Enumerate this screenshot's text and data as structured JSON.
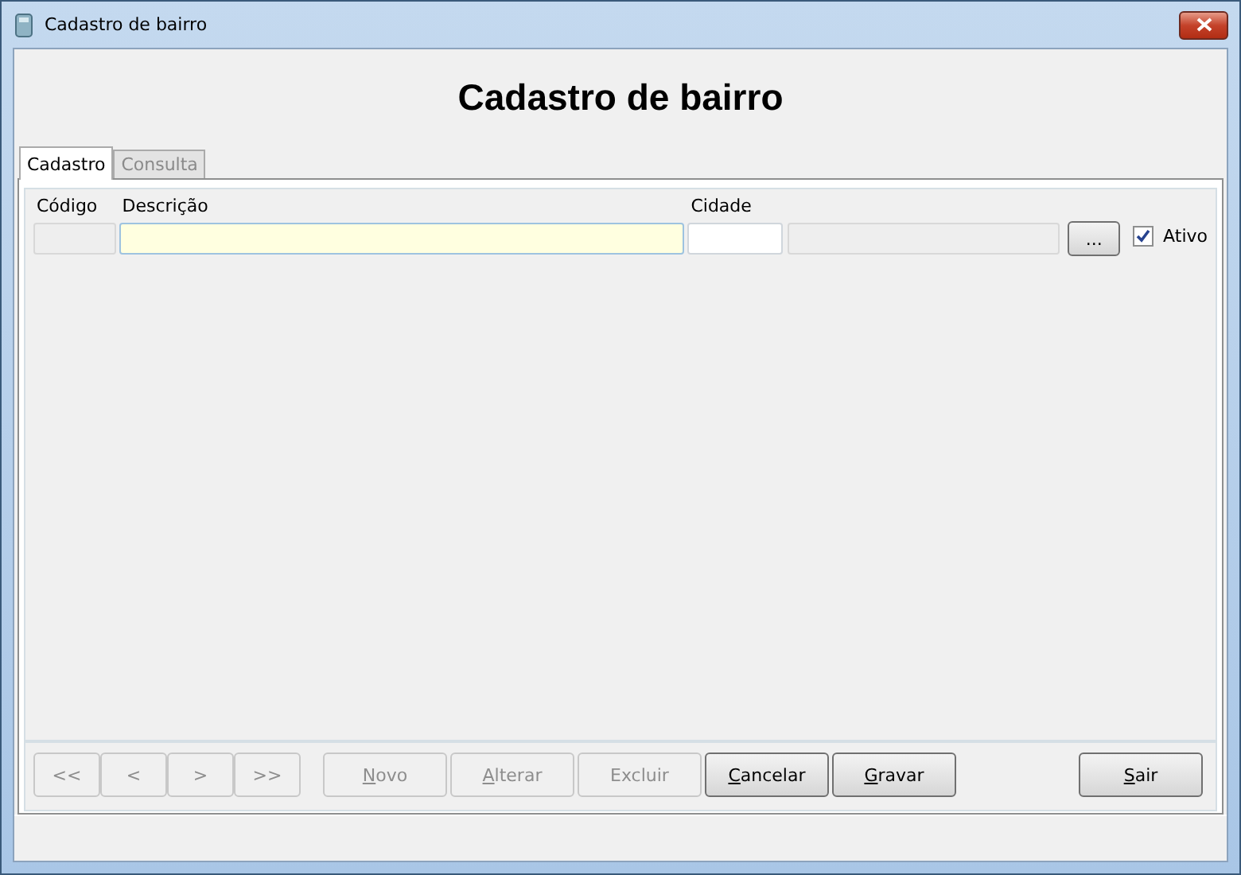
{
  "window": {
    "title": "Cadastro de bairro"
  },
  "heading": "Cadastro de bairro",
  "tabs": [
    {
      "label": "Cadastro",
      "selected": true
    },
    {
      "label": "Consulta",
      "selected": false
    }
  ],
  "form": {
    "codigo": {
      "label": "Código",
      "disabled": true
    },
    "descricao": {
      "label": "Descrição"
    },
    "cidade": {
      "label": "Cidade"
    },
    "lookup_button": "...",
    "ativo": {
      "label": "Ativo",
      "checked": true
    }
  },
  "nav_buttons": [
    {
      "label": "<<",
      "disabled": true
    },
    {
      "label": "<",
      "disabled": true
    },
    {
      "label": ">",
      "disabled": true
    },
    {
      "label": ">>",
      "disabled": true
    }
  ],
  "action_buttons": [
    {
      "label": "Novo",
      "disabled": true,
      "underline_first": true
    },
    {
      "label": "Alterar",
      "disabled": true,
      "underline_first": true
    },
    {
      "label": "Excluir",
      "disabled": true,
      "underline_first": false
    },
    {
      "label": "Cancelar",
      "disabled": false,
      "underline_first": true
    },
    {
      "label": "Gravar",
      "disabled": false,
      "underline_first": true
    }
  ],
  "exit_button": {
    "label": "Sair",
    "disabled": false,
    "underline_first": true
  }
}
